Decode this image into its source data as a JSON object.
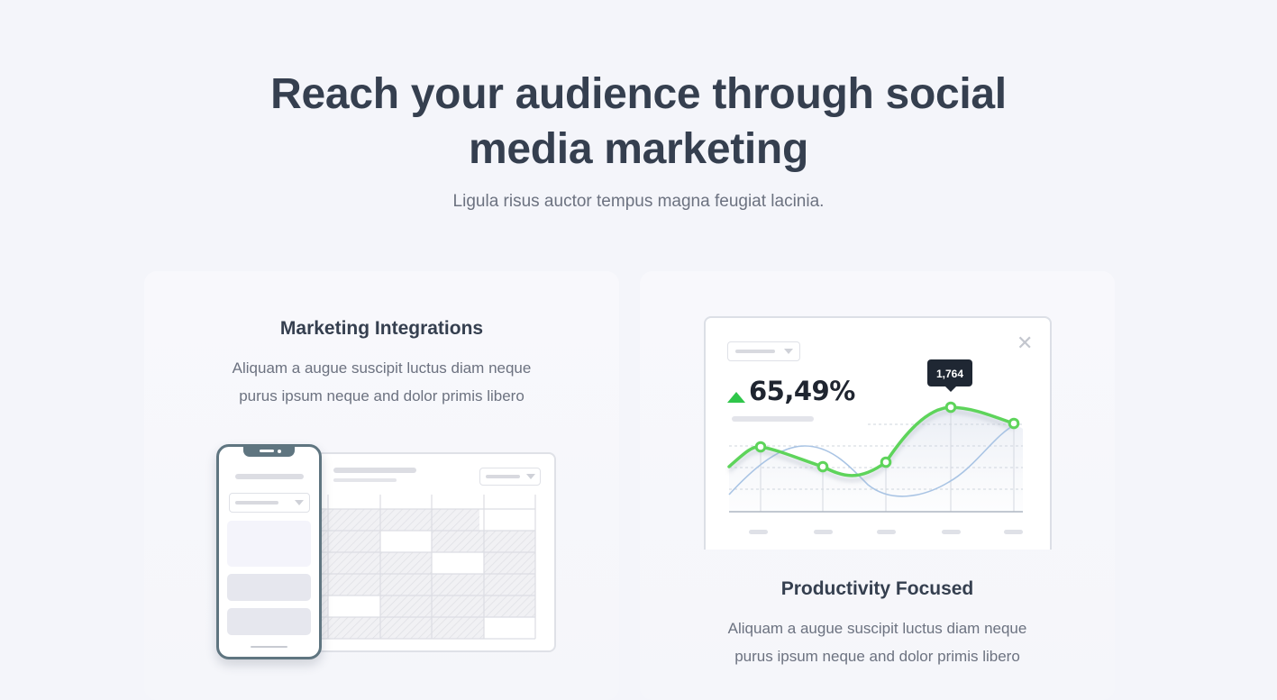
{
  "hero": {
    "title_line1": "Reach your audience through social",
    "title_line2": "media marketing",
    "subtitle": "Ligula risus auctor tempus magna feugiat lacinia."
  },
  "features": [
    {
      "title": "Marketing Integrations",
      "desc_line1": "Aliquam a augue suscipit luctus diam neque",
      "desc_line2": "purus ipsum neque and dolor primis libero"
    },
    {
      "title": "Productivity Focused",
      "desc_line1": "Aliquam a augue suscipit luctus diam neque",
      "desc_line2": "purus ipsum neque and dolor primis libero"
    }
  ],
  "chart_widget": {
    "value": "65,49%",
    "trend_icon": "arrow-up-icon",
    "close_icon": "close-icon",
    "tooltip": "1,764"
  },
  "colors": {
    "accent_green": "#5ed45b",
    "trend_green": "#2fc64a",
    "heading": "#353f4f",
    "body_text": "#6c7280",
    "secondary_line": "#a9c4e4"
  }
}
